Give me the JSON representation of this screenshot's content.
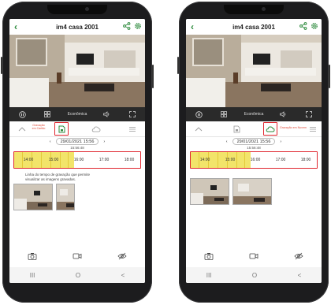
{
  "left_phone": {
    "header": {
      "title": "im4 casa 2001"
    },
    "controls": {
      "mode_label": "Econômica"
    },
    "modes": {
      "sd_label": "Gravação\nem Cartão"
    },
    "date": "29/01/2021 15:56",
    "timestamp": "15:56:48",
    "timeline": {
      "ticks": [
        "14:00",
        "15:00",
        "16:00",
        "17:00",
        "18:00"
      ]
    },
    "caption": "Linha do tempo de gravação que permite visualizar as imagens gravadas."
  },
  "right_phone": {
    "header": {
      "title": "im4 casa 2001"
    },
    "controls": {
      "mode_label": "Econômica"
    },
    "modes": {
      "cloud_label": "Gravação em Nuvem"
    },
    "date": "29/01/2021 15:56",
    "timestamp": "15:56:48",
    "timeline": {
      "ticks": [
        "14:00",
        "15:00",
        "16:00",
        "17:00",
        "18:00"
      ]
    }
  },
  "icons": {
    "back": "chevron-left-icon",
    "share": "share-icon",
    "settings": "gear-icon",
    "pause": "pause-icon",
    "grid": "grid-icon",
    "speaker": "speaker-icon",
    "fullscreen": "fullscreen-icon",
    "sd_card": "sd-card-icon",
    "cloud": "cloud-icon",
    "menu": "menu-icon",
    "camera": "camera-icon",
    "video": "video-icon",
    "privacy": "eye-off-icon"
  },
  "colors": {
    "accent": "#2e8b3e",
    "highlight": "#e0262e",
    "recording": "#f2e46a",
    "controls_bg": "#2a2a2a"
  },
  "nav": {
    "recents": "III",
    "home": "O",
    "back": "<"
  }
}
